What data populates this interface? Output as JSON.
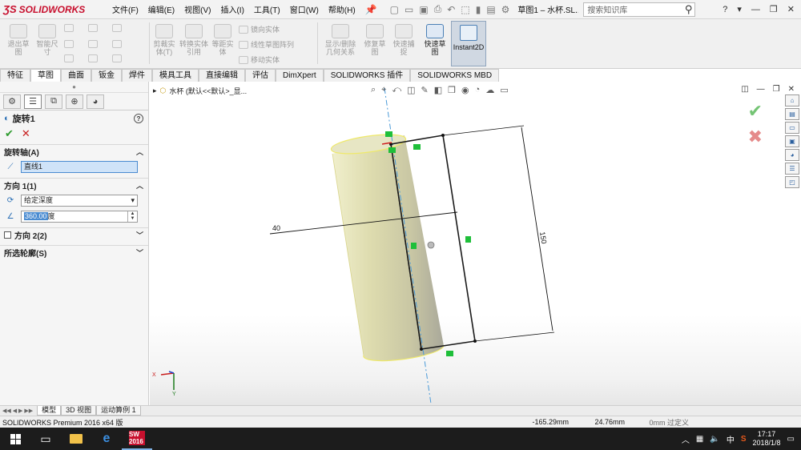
{
  "app": {
    "logo_text": "SOLIDWORKS",
    "doc_title": "草图1 – 水杯.SL...",
    "search_placeholder": "搜索知识库"
  },
  "menu": [
    "文件(F)",
    "编辑(E)",
    "视图(V)",
    "插入(I)",
    "工具(T)",
    "窗口(W)",
    "帮助(H)"
  ],
  "ribbon": {
    "exit_sketch": "退出草图",
    "smart_dim": "智能尺寸",
    "trim": "剪裁实体(T)",
    "convert": "转换实体引用",
    "offset": "等距实体",
    "mirror": "镜向实体",
    "linear_pattern": "线性草图阵列",
    "move": "移动实体",
    "display_relations": "显示/删除几何关系",
    "repair": "修复草图",
    "rapid_snap": "快速捕捉",
    "quick_sketch": "快速草图",
    "instant2d": "Instant2D"
  },
  "tabs": [
    "特征",
    "草图",
    "曲面",
    "钣金",
    "焊件",
    "模具工具",
    "直接编辑",
    "评估",
    "DimXpert",
    "SOLIDWORKS 插件",
    "SOLIDWORKS MBD"
  ],
  "active_tab": "草图",
  "property_manager": {
    "title": "旋转1",
    "axis_section": "旋转轴(A)",
    "axis_value": "直线1",
    "dir1_section": "方向 1(1)",
    "end_condition": "给定深度",
    "angle_value": "360.00度",
    "angle_highlight": "360.00",
    "angle_unit": "度",
    "dir2_section": "方向 2(2)",
    "contours_section": "所选轮廓(S)"
  },
  "viewport": {
    "flyout_label": "水杯 (默认<<默认>_显...",
    "dim_diameter": "40",
    "dim_height": "150"
  },
  "bottom_tabs": [
    "模型",
    "3D 视图",
    "运动算例 1"
  ],
  "status": {
    "app": "SOLIDWORKS Premium 2016 x64 版",
    "x": "-165.29mm",
    "y": "24.76mm",
    "z": "0mm 过定义"
  },
  "taskbar": {
    "sw_label": "SW 2016",
    "ime": "中",
    "time": "17:17",
    "date": "2018/1/8"
  },
  "colors": {
    "accent": "#c8102e",
    "cylinder": "#dedcb0",
    "axis": "#4a9ad8",
    "relation": "#1fbf3a"
  },
  "icons": [
    "solidworks-logo-icon",
    "pin-icon",
    "new-icon",
    "open-icon",
    "save-icon",
    "print-icon",
    "undo-icon",
    "rebuild-icon",
    "options-icon",
    "search-icon",
    "help-icon",
    "minimize-icon",
    "restore-icon",
    "close-icon",
    "revolve-icon",
    "line-icon",
    "check-icon",
    "cancel-icon",
    "refresh-icon",
    "angle-icon",
    "chevron-up-icon",
    "home-icon",
    "windows-logo-icon",
    "task-view-icon",
    "folder-icon",
    "edge-icon"
  ]
}
